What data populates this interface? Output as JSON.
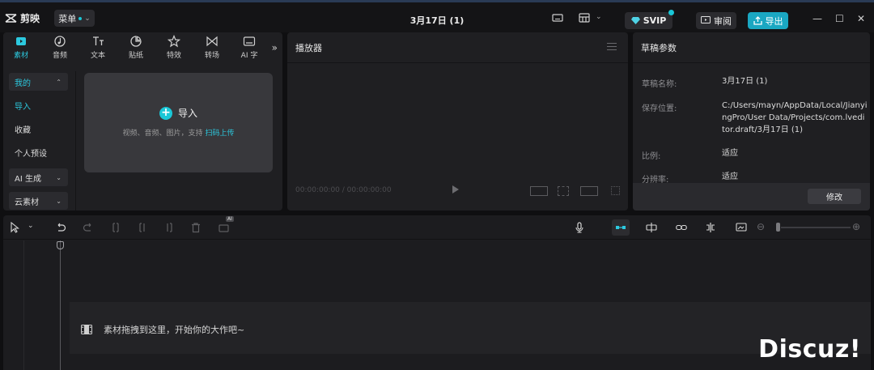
{
  "app": {
    "name": "剪映",
    "menu_label": "菜单",
    "document_title": "3月17日 (1)",
    "svip_label": "SVIP",
    "review_label": "审阅",
    "export_label": "导出"
  },
  "media_panel": {
    "tabs": [
      {
        "label": "素材",
        "icon": "media-icon",
        "active": true
      },
      {
        "label": "音频",
        "icon": "audio-icon",
        "active": false
      },
      {
        "label": "文本",
        "icon": "text-icon",
        "active": false
      },
      {
        "label": "贴纸",
        "icon": "sticker-icon",
        "active": false
      },
      {
        "label": "特效",
        "icon": "effects-icon",
        "active": false
      },
      {
        "label": "转场",
        "icon": "transition-icon",
        "active": false
      },
      {
        "label": "AI 字",
        "icon": "ai-text-icon",
        "active": false
      }
    ],
    "sidebar": {
      "mine": "我的",
      "import": "导入",
      "favorites": "收藏",
      "presets": "个人预设",
      "ai_generate": "AI 生成",
      "cloud": "云素材"
    },
    "import_box": {
      "title": "导入",
      "subtitle": "视频、音频、图片，支持",
      "link": "扫码上传"
    }
  },
  "player": {
    "title": "播放器",
    "timecode": "00:00:00:00 / 00:00:00:00"
  },
  "draft_params": {
    "title": "草稿参数",
    "rows": [
      {
        "label": "草稿名称:",
        "value": "3月17日 (1)"
      },
      {
        "label": "保存位置:",
        "value": "C:/Users/mayn/AppData/Local/JianyingPro/User Data/Projects/com.lveditor.draft/3月17日 (1)"
      },
      {
        "label": "比例:",
        "value": "适应"
      },
      {
        "label": "分辨率:",
        "value": "适应"
      }
    ],
    "edit_label": "修改"
  },
  "timeline": {
    "drop_hint": "素材拖拽到这里，开始你的大作吧~",
    "badge": "AI"
  },
  "watermark": "Discuz!",
  "colors": {
    "accent": "#1ac7d7",
    "active_tab": "#2cc9df",
    "export_bg": "#1aa7c2"
  }
}
